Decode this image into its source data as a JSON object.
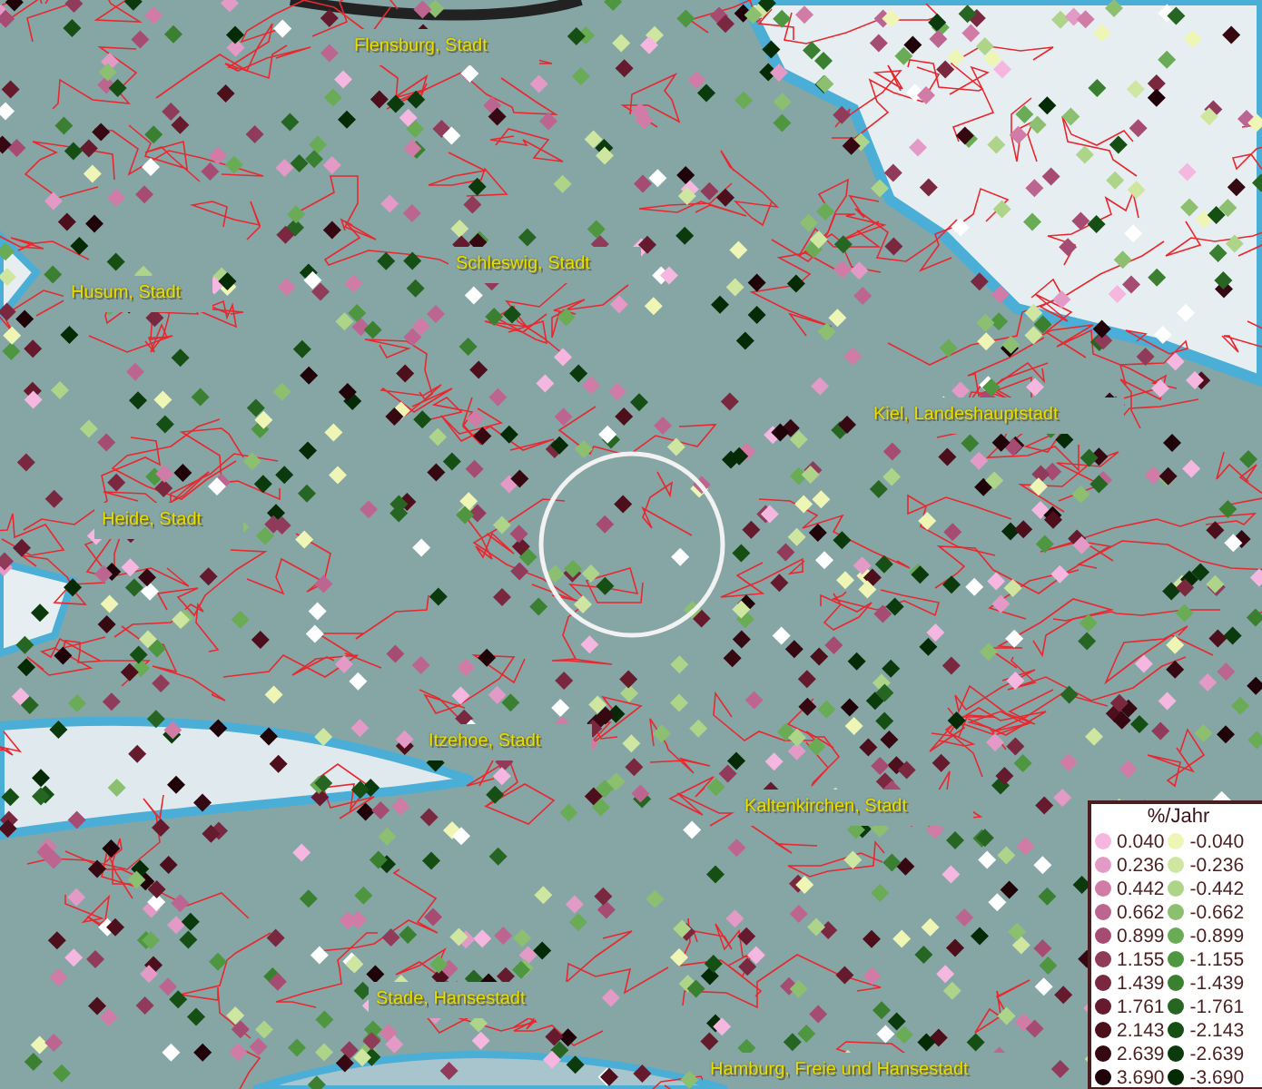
{
  "map": {
    "labels": [
      {
        "text": "Flensburg, Stadt"
      },
      {
        "text": "Schleswig, Stadt"
      },
      {
        "text": "Husum, Stadt"
      },
      {
        "text": "Kiel, Landeshauptstadt"
      },
      {
        "text": "Heide, Stadt"
      },
      {
        "text": "Itzehoe, Stadt"
      },
      {
        "text": "Kaltenkirchen, Stadt"
      },
      {
        "text": "Stade, Hansestadt"
      },
      {
        "text": "Hamburg, Freie und Hansestadt"
      }
    ]
  },
  "legend": {
    "title": "%/Jahr",
    "positive": [
      {
        "value": "0.040",
        "color": "#f5b6e0"
      },
      {
        "value": "0.236",
        "color": "#e49ac6"
      },
      {
        "value": "0.442",
        "color": "#d07ca6"
      },
      {
        "value": "0.662",
        "color": "#bc6590"
      },
      {
        "value": "0.899",
        "color": "#a64c73"
      },
      {
        "value": "1.155",
        "color": "#913b5b"
      },
      {
        "value": "1.439",
        "color": "#7a2840"
      },
      {
        "value": "1.761",
        "color": "#651b2d"
      },
      {
        "value": "2.143",
        "color": "#4c0f1b"
      },
      {
        "value": "2.639",
        "color": "#360812"
      },
      {
        "value": "3.690",
        "color": "#1f0308"
      }
    ],
    "negative": [
      {
        "value": "-0.040",
        "color": "#eef5b5"
      },
      {
        "value": "-0.236",
        "color": "#cfe6a0"
      },
      {
        "value": "-0.442",
        "color": "#aed48a"
      },
      {
        "value": "-0.662",
        "color": "#8cc070"
      },
      {
        "value": "-0.899",
        "color": "#6aab55"
      },
      {
        "value": "-1.155",
        "color": "#4f9640"
      },
      {
        "value": "-1.439",
        "color": "#3a8030"
      },
      {
        "value": "-1.761",
        "color": "#276622"
      },
      {
        "value": "-2.143",
        "color": "#154f14"
      },
      {
        "value": "-2.639",
        "color": "#0b3a0c"
      },
      {
        "value": "-3.690",
        "color": "#052a06"
      }
    ]
  }
}
